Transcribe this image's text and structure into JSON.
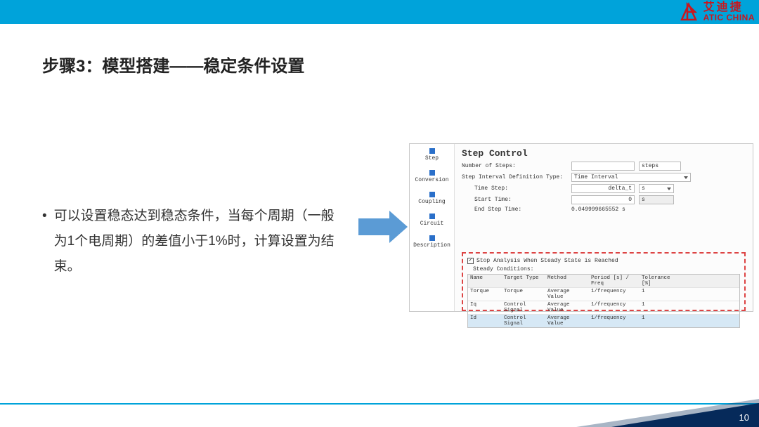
{
  "logo": {
    "cn": "艾迪捷",
    "en": "ATIC CHINA"
  },
  "title": "步骤3：模型搭建——稳定条件设置",
  "body": {
    "bullet": "•",
    "text": "可以设置稳态达到稳态条件，当每个周期（一般为1个电周期）的差值小于1%时，计算设置为结束。"
  },
  "sidebar": [
    "Step",
    "Conversion",
    "Coupling",
    "Circuit",
    "Description"
  ],
  "panel": {
    "title": "Step Control",
    "num_steps_label": "Number of Steps:",
    "num_steps_value": "",
    "num_steps_unit": "steps",
    "interval_type_label": "Step Interval Definition Type:",
    "interval_type_value": "Time Interval",
    "time_step_label": "Time Step:",
    "time_step_value": "delta_t",
    "time_step_unit": "s",
    "start_time_label": "Start Time:",
    "start_time_value": "0",
    "start_time_unit": "s",
    "end_step_time_label": "End Step Time:",
    "end_step_time_value": "0.049999665552 s",
    "steady": {
      "checkbox": "Stop Analysis When Steady State is Reached",
      "conditions_label": "Steady Conditions:",
      "headers": [
        "Name",
        "Target Type",
        "Method",
        "Period [s] / Freq",
        "Tolerance [%]"
      ],
      "rows": [
        [
          "Torque",
          "Torque",
          "Average Value",
          "1/frequency",
          "1"
        ],
        [
          "Iq",
          "Control Signal",
          "Average Value",
          "1/frequency",
          "1"
        ],
        [
          "Id",
          "Control Signal",
          "Average Value",
          "1/frequency",
          "1"
        ]
      ]
    }
  },
  "page_num": "10"
}
